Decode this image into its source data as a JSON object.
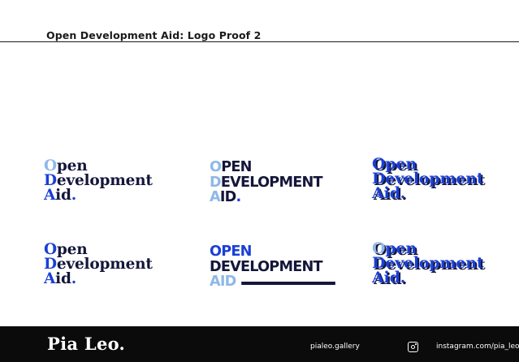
{
  "header": {
    "title": "Open Development Aid: Logo Proof 2"
  },
  "logos": {
    "v1": {
      "o": "O",
      "pen": "pen",
      "d": "D",
      "evelopment": "evelopment",
      "a": "A",
      "id": "id",
      "dot": "."
    },
    "v2": {
      "o": "O",
      "pen": "PEN",
      "d": "D",
      "evelopment": "EVELOPMENT",
      "a": "A",
      "id": "ID",
      "dot": "."
    },
    "v3": {
      "o": "O",
      "pen": "pen",
      "d": "D",
      "evelopment": "evelopment",
      "a": "A",
      "id": "id",
      "dot": "."
    },
    "v4": {
      "o": "O",
      "pen": "pen",
      "d": "D",
      "evelopment": "evelopment",
      "a": "A",
      "id": "id",
      "dot": "."
    },
    "v5": {
      "open": "OPEN",
      "development": "DEVELOPMENT",
      "aid": "AID"
    },
    "v6": {
      "o": "O",
      "pen": "pen",
      "d": "D",
      "evelopment": "evelopment",
      "a": "A",
      "id": "id",
      "dot": "."
    }
  },
  "colors": {
    "navy": "#14163a",
    "blue": "#1a3fd6",
    "light_blue": "#8eb8e8",
    "footer": "#0b0b0b"
  },
  "footer": {
    "brand": "Pia Leo.",
    "website": "pialeo.gallery",
    "instagram_icon": "instagram-icon",
    "instagram_handle": "instagram.com/pia_leo"
  }
}
